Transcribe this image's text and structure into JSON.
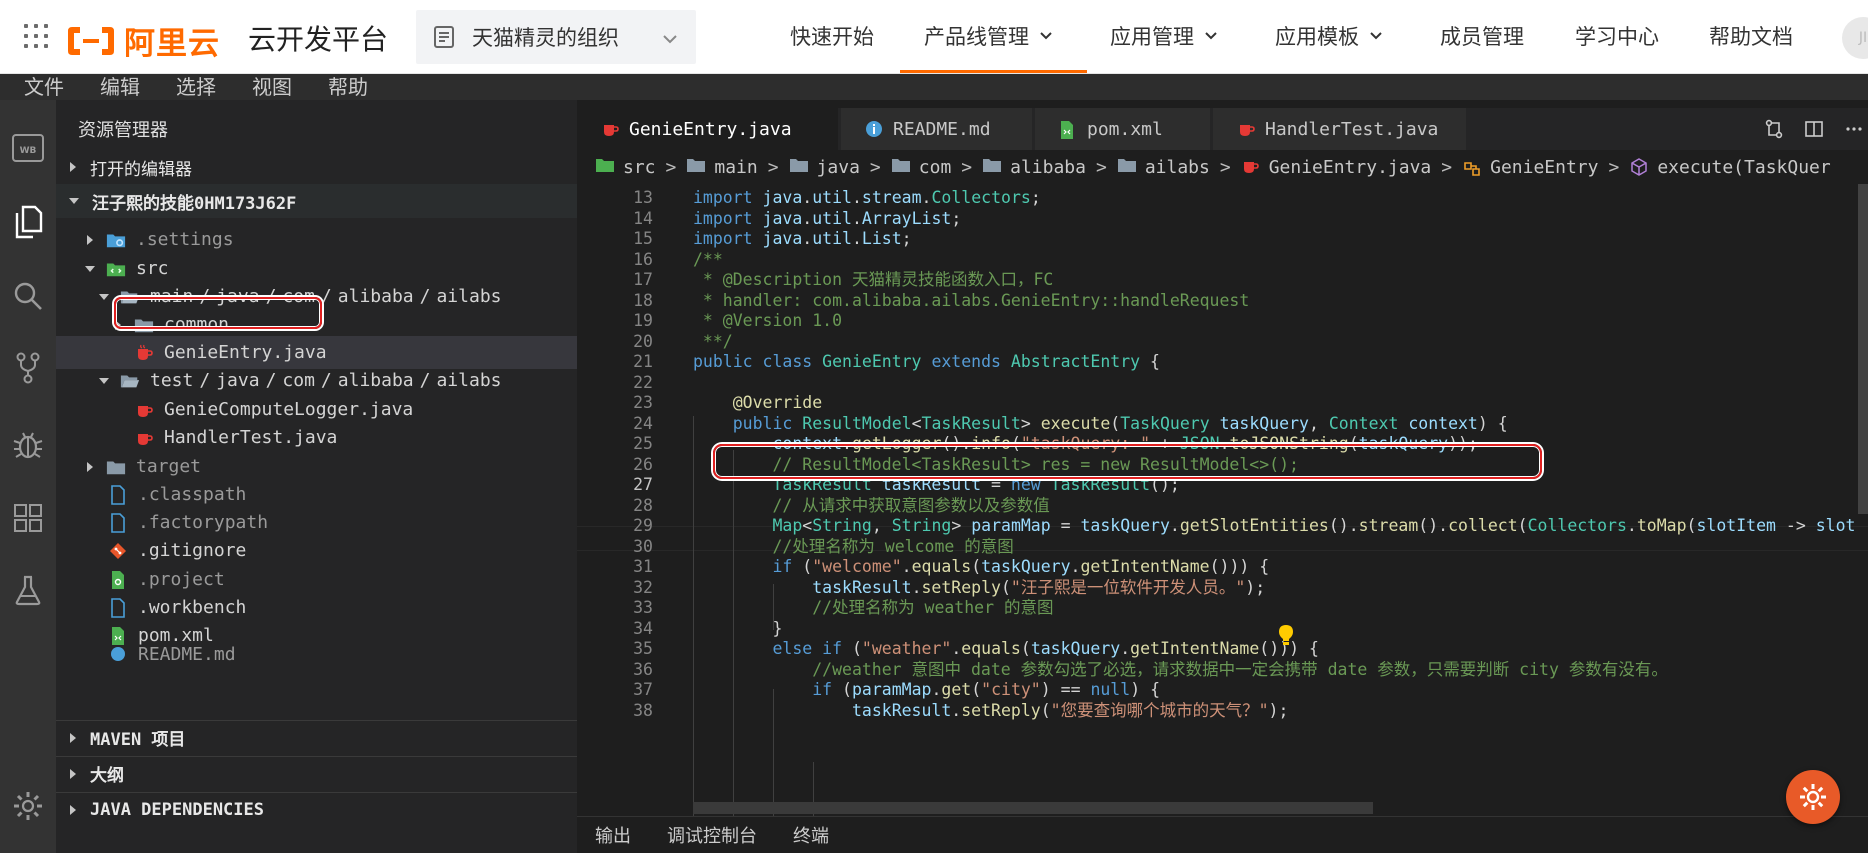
{
  "topnav": {
    "logo_text": "阿里云",
    "platform_title": "云开发平台",
    "org_name": "天猫精灵的组织",
    "nav": [
      "快速开始",
      "产品线管理",
      "应用管理",
      "应用模板",
      "成员管理",
      "学习中心",
      "帮助文档"
    ],
    "nav_active": "产品线管理",
    "avatar_text": "JI",
    "brand_color": "#ff6a00"
  },
  "menubar": [
    "文件",
    "编辑",
    "选择",
    "视图",
    "帮助"
  ],
  "sidebar": {
    "title": "资源管理器",
    "sections": {
      "open_editors": "打开的编辑器",
      "project": "汪子熙的技能0HM173J62F",
      "maven": "MAVEN 项目",
      "outline": "大纲",
      "java_deps": "JAVA DEPENDENCIES"
    },
    "tree": {
      "settings": ".settings",
      "src": "src",
      "main_path": [
        "main",
        "java",
        "com",
        "alibaba",
        "ailabs"
      ],
      "common": "common",
      "genie_entry": "GenieEntry.java",
      "test_path": [
        "test",
        "java",
        "com",
        "alibaba",
        "ailabs"
      ],
      "genie_logger": "GenieComputeLogger.java",
      "handler_test": "HandlerTest.java",
      "target": "target",
      "classpath": ".classpath",
      "factorypath": ".factorypath",
      "gitignore": ".gitignore",
      "project": ".project",
      "workbench": ".workbench",
      "pom": "pom.xml",
      "readme": "README.md"
    }
  },
  "editor": {
    "tabs": [
      "GenieEntry.java",
      "README.md",
      "pom.xml",
      "HandlerTest.java"
    ],
    "active_tab": "GenieEntry.java",
    "breadcrumb": [
      "src",
      "main",
      "java",
      "com",
      "alibaba",
      "ailabs",
      "GenieEntry.java",
      "GenieEntry",
      "execute(TaskQuer"
    ],
    "current_line": "27",
    "lines": [
      {
        "n": "13",
        "text": "import java.util.stream.Collectors;"
      },
      {
        "n": "14",
        "text": "import java.util.ArrayList;"
      },
      {
        "n": "15",
        "text": "import java.util.List;"
      },
      {
        "n": "16",
        "text": "/**"
      },
      {
        "n": "17",
        "text": " * @Description 天猫精灵技能函数入口，FC"
      },
      {
        "n": "18",
        "text": " * handler: com.alibaba.ailabs.GenieEntry::handleRequest"
      },
      {
        "n": "19",
        "text": " * @Version 1.0"
      },
      {
        "n": "20",
        "text": " **/"
      },
      {
        "n": "21",
        "text": "public class GenieEntry extends AbstractEntry {"
      },
      {
        "n": "22",
        "text": ""
      },
      {
        "n": "23",
        "text": "    @Override"
      },
      {
        "n": "24",
        "text": "    public ResultModel<TaskResult> execute(TaskQuery taskQuery, Context context) {"
      },
      {
        "n": "25",
        "text": "        context.getLogger().info(\"taskQuery: \" + JSON.toJSONString(taskQuery));"
      },
      {
        "n": "26",
        "text": "        // ResultModel<TaskResult> res = new ResultModel<>();"
      },
      {
        "n": "27",
        "text": "        TaskResult taskResult = new TaskResult();"
      },
      {
        "n": "28",
        "text": "        // 从请求中获取意图参数以及参数值"
      },
      {
        "n": "29",
        "text": "        Map<String, String> paramMap = taskQuery.getSlotEntities().stream().collect(Collectors.toMap(slotItem -> slot"
      },
      {
        "n": "30",
        "text": "        //处理名称为 welcome 的意图"
      },
      {
        "n": "31",
        "text": "        if (\"welcome\".equals(taskQuery.getIntentName())) {"
      },
      {
        "n": "32",
        "text": "            taskResult.setReply(\"汪子熙是一位软件开发人员。\");"
      },
      {
        "n": "33",
        "text": "            //处理名称为 weather 的意图"
      },
      {
        "n": "34",
        "text": "        }"
      },
      {
        "n": "35",
        "text": "        else if (\"weather\".equals(taskQuery.getIntentName())) {"
      },
      {
        "n": "36",
        "text": "            //weather 意图中 date 参数勾选了必选，请求数据中一定会携带 date 参数，只需要判断 city 参数有没有。"
      },
      {
        "n": "37",
        "text": "            if (paramMap.get(\"city\") == null) {"
      },
      {
        "n": "38",
        "text": "                taskResult.setReply(\"您要查询哪个城市的天气？\");"
      }
    ]
  },
  "panel": [
    "输出",
    "调试控制台",
    "终端"
  ]
}
